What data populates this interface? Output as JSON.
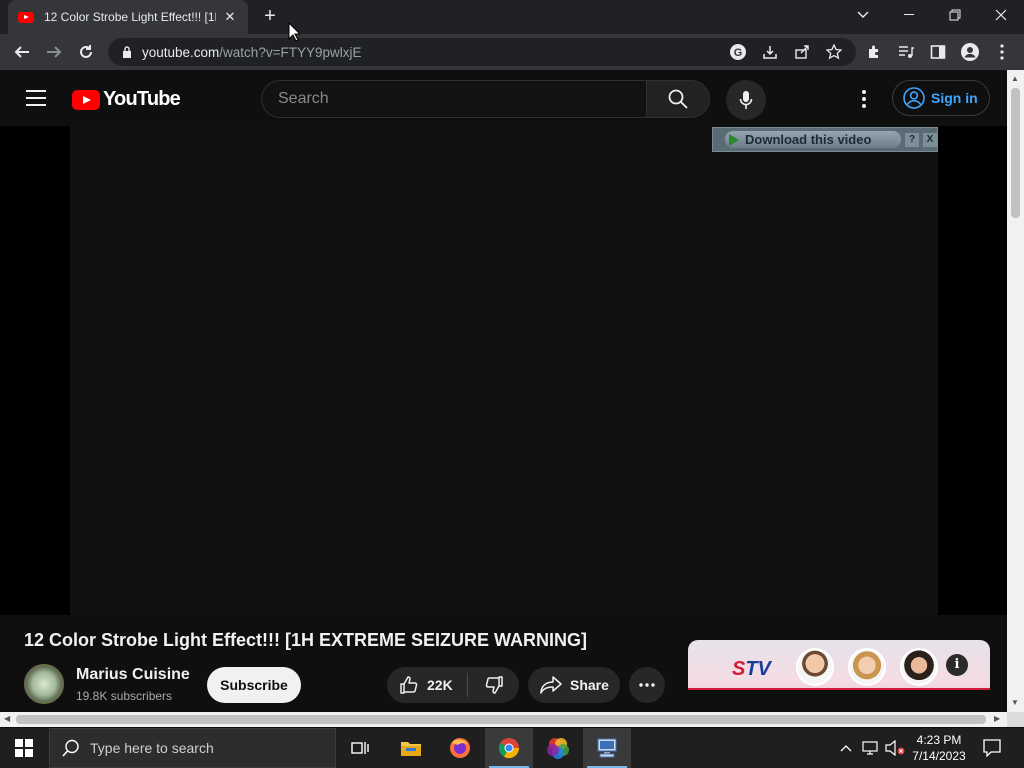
{
  "browser": {
    "tab_title": "12 Color Strobe Light Effect!!! [1H EXTREME SEIZURE WARNING]",
    "tab_close": "✕",
    "new_tab": "+",
    "url_host": "youtube.com",
    "url_path": "/watch?v=FTYY9pwlxjE"
  },
  "youtube": {
    "logo_text": "YouTube",
    "search_placeholder": "Search",
    "sign_in": "Sign in"
  },
  "download_bar": {
    "label": "Download this video",
    "help": "?",
    "close": "X"
  },
  "video": {
    "title": "12 Color Strobe Light Effect!!! [1H EXTREME SEIZURE WARNING]",
    "channel_name": "Marius Cuisine",
    "subscribers": "19.8K subscribers",
    "subscribe_label": "Subscribe",
    "likes": "22K",
    "share_label": "Share"
  },
  "ad": {
    "brand_s": "S",
    "brand_tv": "TV"
  },
  "taskbar": {
    "search_placeholder": "Type here to search",
    "time": "4:23 PM",
    "date": "7/14/2023"
  },
  "colors": {
    "yt_red": "#ff0000",
    "signin_blue": "#3ea6ff",
    "bg": "#0f0f0f"
  }
}
